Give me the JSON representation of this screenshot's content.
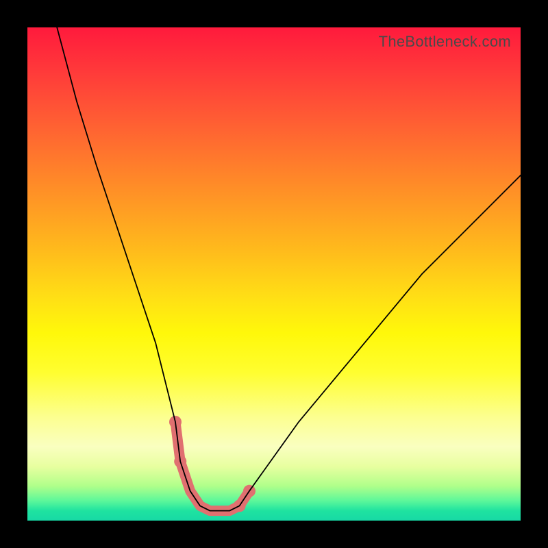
{
  "attribution": "TheBottleneck.com",
  "colors": {
    "red": "#ff1a3c",
    "green": "#17d9a5",
    "curve": "#000000",
    "marker": "#e07070"
  },
  "chart_data": {
    "type": "line",
    "title": "",
    "xlabel": "",
    "ylabel": "",
    "xlim": [
      0,
      100
    ],
    "ylim": [
      0,
      100
    ],
    "grid": false,
    "series": [
      {
        "name": "bottleneck-curve",
        "x": [
          6,
          10,
          14,
          18,
          22,
          26,
          30,
          31,
          33,
          35,
          37,
          39,
          41,
          43,
          45,
          50,
          55,
          60,
          65,
          70,
          75,
          80,
          85,
          90,
          95,
          100
        ],
        "y": [
          100,
          85,
          72,
          60,
          48,
          36,
          20,
          12,
          6,
          3,
          2,
          2,
          2,
          3,
          6,
          13,
          20,
          26,
          32,
          38,
          44,
          50,
          55,
          60,
          65,
          70
        ]
      }
    ],
    "highlighted_region": {
      "x": [
        30,
        31,
        33,
        35,
        37,
        39,
        41,
        43,
        45
      ],
      "y": [
        20,
        12,
        6,
        3,
        2,
        2,
        2,
        3,
        6
      ]
    }
  }
}
